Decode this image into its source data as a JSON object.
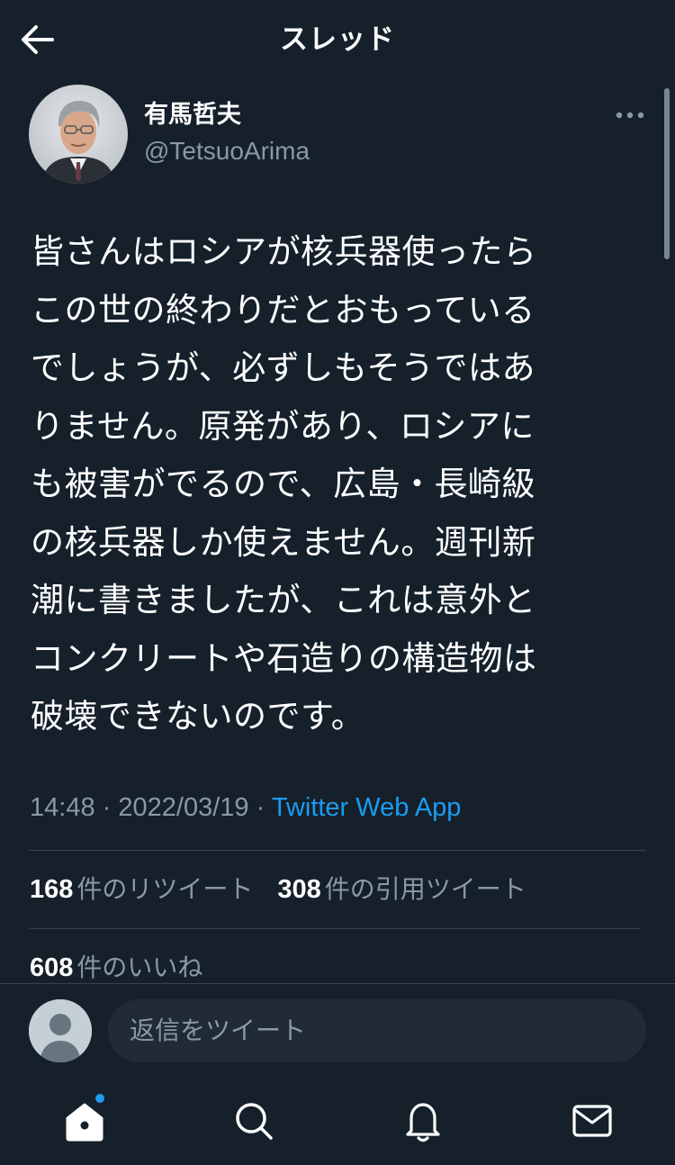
{
  "header": {
    "title": "スレッド",
    "back_icon": "arrow-left-icon"
  },
  "tweet": {
    "author": {
      "display_name": "有馬哲夫",
      "handle": "@TetsuoArima"
    },
    "text": "皆さんはロシアが核兵器使ったら\nこの世の終わりだとおもっている\nでしょうが、必ずしもそうではあ\nりません。原発があり、ロシアに\nも被害がでるので、広島・長崎級\nの核兵器しか使えません。週刊新\n潮に書きましたが、これは意外と\nコンクリートや石造りの構造物は\n破壊できないのです。",
    "time": "14:48",
    "separator": "·",
    "date": "2022/03/19",
    "source": "Twitter Web App",
    "stats": {
      "retweets_count": "168",
      "retweets_label": "件のリツイート",
      "quotes_count": "308",
      "quotes_label": "件の引用ツイート",
      "likes_count": "608",
      "likes_label": "件のいいね"
    }
  },
  "reply": {
    "placeholder": "返信をツイート"
  },
  "tabs": [
    {
      "name": "home",
      "icon": "home-icon",
      "has_badge": true
    },
    {
      "name": "search",
      "icon": "search-icon"
    },
    {
      "name": "notifications",
      "icon": "bell-icon"
    },
    {
      "name": "messages",
      "icon": "mail-icon"
    }
  ],
  "colors": {
    "background": "#15202b",
    "accent": "#1d9bf0",
    "secondary_text": "#8b98a5",
    "divider": "#38444d"
  }
}
